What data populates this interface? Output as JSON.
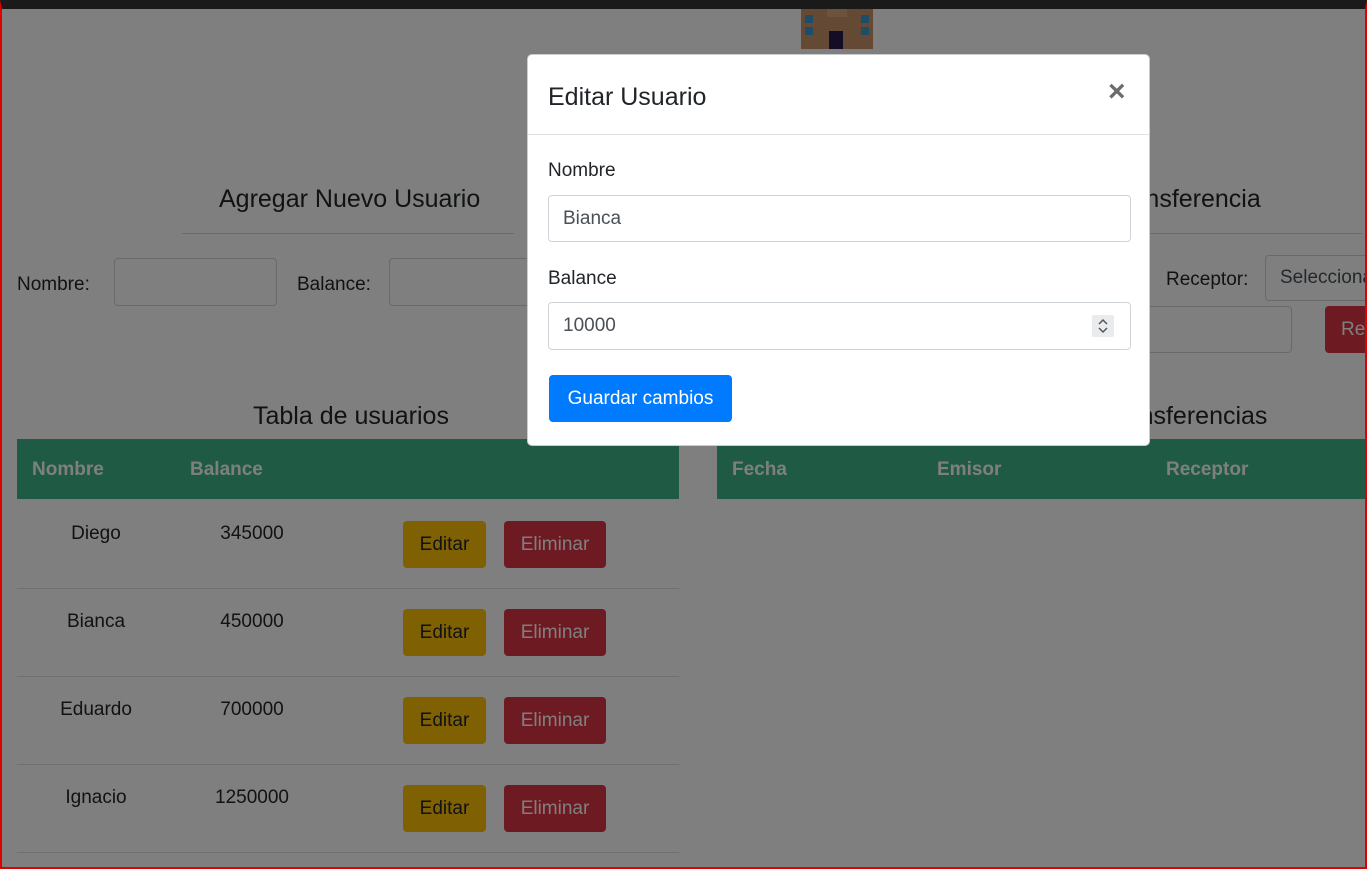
{
  "page": {
    "add_user_title": "Agregar Nuevo Usuario",
    "transfer_title": "Realizar una Transferencia",
    "add_form": {
      "name_label": "Nombre:",
      "balance_label": "Balance:"
    },
    "transfer_form": {
      "receiver_label": "Receptor:",
      "receiver_select": "Selecciona un usuario",
      "submit": "Realizar"
    },
    "users_table": {
      "title": "Tabla de usuarios",
      "columns": [
        "Nombre",
        "Balance"
      ],
      "edit_label": "Editar",
      "delete_label": "Eliminar",
      "rows": [
        {
          "name": "Diego",
          "balance": "345000"
        },
        {
          "name": "Bianca",
          "balance": "450000"
        },
        {
          "name": "Eduardo",
          "balance": "700000"
        },
        {
          "name": "Ignacio",
          "balance": "1250000"
        }
      ]
    },
    "transfers_table": {
      "title": "Tabla de Transferencias",
      "columns": [
        "Fecha",
        "Emisor",
        "Receptor"
      ]
    }
  },
  "modal": {
    "title": "Editar Usuario",
    "close": "×",
    "name_label": "Nombre",
    "name_value": "Bianca",
    "balance_label": "Balance",
    "balance_value": "10000",
    "save_label": "Guardar cambios"
  },
  "colors": {
    "table_header": "#3eb489",
    "primary": "#007bff",
    "warning": "#ffc107",
    "danger": "#dc3545",
    "backdrop": "rgba(0,0,0,0.5)"
  }
}
